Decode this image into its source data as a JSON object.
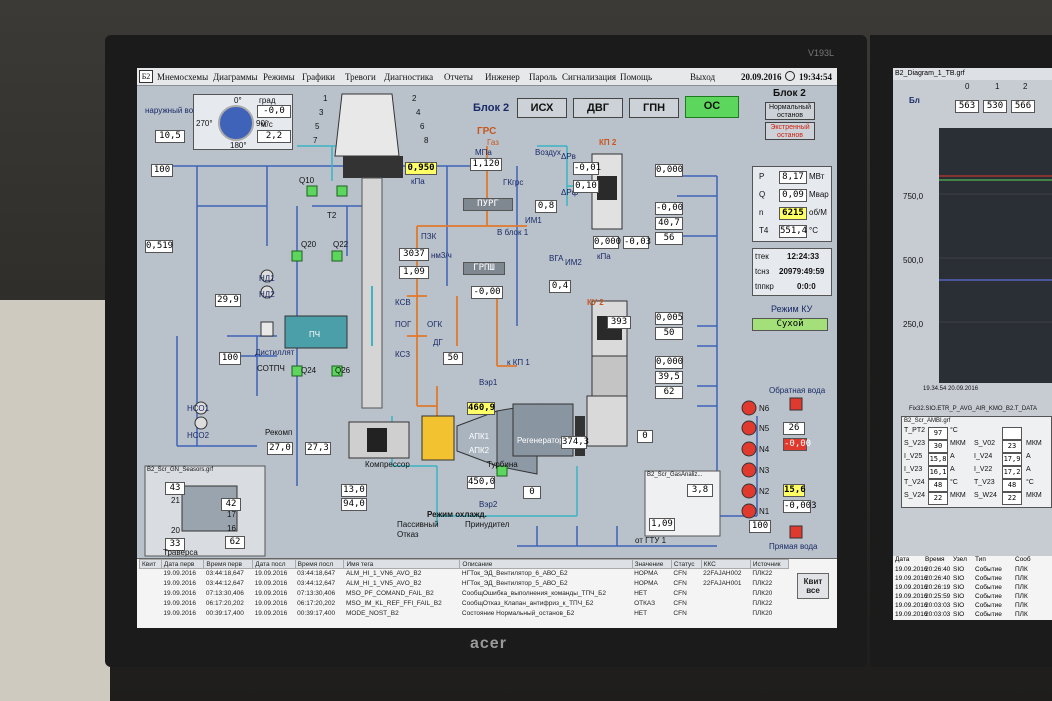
{
  "monitor": {
    "brand": "acer",
    "model": "V193L"
  },
  "menu": {
    "logo": "Б2",
    "items": [
      "Мнемосхемы",
      "Диаграммы",
      "Режимы",
      "Графики",
      "Тревоги",
      "Диагностика",
      "Отчеты",
      "Инженер",
      "Пароль",
      "Сигнализация",
      "Помощь"
    ],
    "exit": "Выход",
    "date": "20.09.2016",
    "time": "19:34:54"
  },
  "header": {
    "block_label": "Блок 2",
    "mode_buttons": [
      "ИСХ",
      "ДВГ",
      "ГПН",
      "ОС"
    ],
    "active_mode": "ОС",
    "right_title": "Блок 2",
    "normal_stop": "Нормальный останов",
    "emergency_stop": "Экстренный останов"
  },
  "weather": {
    "outside_air_label": "наружный воздух",
    "air_temp": "10,5",
    "wind_deg_label": "град",
    "wind_deg": "-0,0",
    "wind_speed_label": "м/с",
    "wind_speed": "2,2",
    "compass": [
      "0°",
      "90°",
      "180°",
      "270°"
    ]
  },
  "power_panel": {
    "rows": [
      {
        "name": "P",
        "value": "8,17",
        "unit": "МВт"
      },
      {
        "name": "Q",
        "value": "0,09",
        "unit": "Мвар"
      },
      {
        "name": "n",
        "value": "6215",
        "unit": "об/М"
      },
      {
        "name": "T4",
        "value": "551,4",
        "unit": "°C"
      }
    ],
    "ttek_label": "tтек",
    "ttek": "12:24:33",
    "tsnz_label": "tснз",
    "tsnz": "20979:49:59",
    "tppk_label": "tппкр",
    "tppk": "0:0:0",
    "ku_mode_label": "Режим КУ",
    "ku_mode": "Сухой"
  },
  "gas": {
    "grs": "ГРС",
    "gas_label": "Газ",
    "mpa": "МПа",
    "grs_pressure": "1,120",
    "gkgrs": "ГКгрс",
    "purg": "ПУРГ",
    "v_block": "В блок 1",
    "pzk": "ПЗК",
    "flow": "3037",
    "flow_unit": "нм3/ч",
    "p2": "1,09",
    "grpsh": "ГРПШ",
    "p3": "-0,00",
    "ksv": "КСВ",
    "kpg": "ПОГ",
    "ogk": "ОГК",
    "dg": "ДГ",
    "ksz": "КСЗ",
    "val50": "50",
    "to_kp1": "к КП 1"
  },
  "filter": {
    "vozduh": "Воздух",
    "im1": "ИМ1",
    "im2": "ИМ2",
    "vga": "ВГА",
    "dpv": "ΔРв",
    "dpf": "ΔРф",
    "v08": "0,8",
    "v04": "0,4",
    "kp2": "КП 2",
    "p_a": "-0,01",
    "p_b": "0,10",
    "p_c": "0,000",
    "p_d": "-0,03",
    "kpa": "кПа"
  },
  "kp2_right": {
    "v1": "0,000",
    "v2": "-0,00",
    "v3": "40,7",
    "v4": "56"
  },
  "ku2": {
    "label": "КУ 2",
    "temp": "393",
    "v1": "0,005",
    "v2": "50",
    "v3": "0,000",
    "v4": "39,5",
    "v5": "62"
  },
  "left": {
    "v100": "100",
    "v0519": "0,519",
    "v299": "29,9",
    "v100b": "100",
    "nd1": "НД1",
    "nd2": "НД2",
    "nso1": "НСО1",
    "nso2": "НСО2",
    "sotpch": "СОТПЧ",
    "distil": "Дистиллят",
    "q10": "Q10",
    "q20": "Q20",
    "q22": "Q22",
    "q24": "Q24",
    "q26": "Q26",
    "t2": "T2",
    "pch": "ПЧ"
  },
  "stack": {
    "p0950": "0,950",
    "kpa": "кПа"
  },
  "turbine": {
    "compressor": "Компрессор",
    "turbine": "Турбина",
    "regenerator": "Регенератор",
    "apk1": "АПК1",
    "apk2": "АПК2",
    "t4609": "460,9",
    "t4500": "450,0",
    "t3743": "374,3",
    "v0": "0",
    "v0b": "0",
    "bzr1": "Вэр1",
    "bzr2": "Вэр2",
    "v130": "13,0",
    "v940": "94,0",
    "v270": "27,0",
    "v273": "27,3",
    "vraschenie": "Рекомп"
  },
  "cooling": {
    "title": "Режим охлажд.",
    "passive": "Пассивный",
    "forced": "Принудител",
    "fail": "Отказ"
  },
  "gas_small_win": {
    "title": "B2_Scr_GasAnaliz...",
    "v1": "3,8",
    "v2": "1,09"
  },
  "seals_win": {
    "title": "B2_Scr_GN_Seasors.grf",
    "v1": "43",
    "v2": "42",
    "v3": "33",
    "v4": "62",
    "n21": "21",
    "n20": "20",
    "n17": "17",
    "n16": "16",
    "traversa": "Траверса"
  },
  "water": {
    "return_label": "Обратная вода",
    "direct_label": "Прямая вода",
    "pumps": [
      "N6",
      "N5",
      "N4",
      "N3",
      "N2",
      "N1"
    ],
    "v26": "26",
    "vm000": "-0,00",
    "v156": "15,6",
    "vm0003": "-0,003",
    "v100": "100",
    "from_gtu": "от ГТУ 1"
  },
  "sieve_bins": [
    {
      "no": "1",
      "state": "ok"
    },
    {
      "no": "2",
      "state": "ok"
    },
    {
      "no": "3",
      "state": "ok"
    },
    {
      "no": "4",
      "state": "ok"
    },
    {
      "no": "5",
      "state": "ok"
    },
    {
      "no": "6",
      "state": "ok"
    },
    {
      "no": "7",
      "state": "ok"
    },
    {
      "no": "8",
      "state": "ok"
    }
  ],
  "events": {
    "columns": [
      "Квит",
      "Дата перв",
      "Время перв",
      "Дата посл",
      "Время посл",
      "Имя тега",
      "Описание",
      "Значение",
      "Статус",
      "ККС",
      "Источник"
    ],
    "rows": [
      [
        "",
        "19.09.2016",
        "03:44:18,647",
        "19.09.2016",
        "03:44:18,647",
        "ALM_HI_1_VN6_AVO_B2",
        "НГТок_ЭД_Вентилятор_6_АВО_Б2",
        "НОРМА",
        "CFN",
        "22FAJAH002",
        "ПЛК22"
      ],
      [
        "",
        "19.09.2016",
        "03:44:12,647",
        "19.09.2016",
        "03:44:12,647",
        "ALM_HI_1_VN5_AVO_B2",
        "НГТок_ЭД_Вентилятор_5_АВО_Б2",
        "НОРМА",
        "CFN",
        "22FAJAH001",
        "ПЛК22"
      ],
      [
        "",
        "19.09.2016",
        "07:13:30,406",
        "19.09.2016",
        "07:13:30,406",
        "MSO_PF_COMAND_FAIL_B2",
        "СообщОшибка_выполнения_команды_ТПЧ_Б2",
        "НЕТ",
        "CFN",
        "",
        "ПЛК20"
      ],
      [
        "",
        "19.09.2016",
        "06:17:20,202",
        "19.09.2016",
        "06:17:20,202",
        "MSO_IM_KL_REF_FFI_FAIL_B2",
        "СообщОтказ_Клапан_антифриз_к_ТПЧ_Б2",
        "ОТКАЗ",
        "CFN",
        "",
        "ПЛК22"
      ],
      [
        "",
        "19.09.2016",
        "00:39:17,400",
        "19.09.2016",
        "00:39:17,400",
        "MODE_NOST_B2",
        "Состояние Нормальный_останов_Б2",
        "НЕТ",
        "CFN",
        "",
        "ПЛК20"
      ]
    ],
    "kvit_all": "Квит все"
  },
  "screen2": {
    "title": "B2_Diagram_1_TB.grf",
    "block_label": "Бл",
    "counters": [
      "563",
      "530",
      "566"
    ],
    "counters_top": [
      "0",
      "1",
      "2"
    ],
    "y_ticks": [
      "750,0",
      "500,0",
      "250,0"
    ],
    "chart_date": "19.34.54 20.09.2016",
    "trend_title": "Fix32.SIO.ETR_P_AVG_AIR_KMO_B2.T_DATA",
    "amb_title": "B2_Scr_AMBI.grf",
    "amb_rows": [
      {
        "l": "T_PT2",
        "v": "97",
        "u": "°C",
        "l2": "",
        "v2": "",
        "u2": ""
      },
      {
        "l": "S_V23",
        "v": "30",
        "u": "МКМ",
        "l2": "S_V02",
        "v2": "23",
        "u2": "МКМ"
      },
      {
        "l": "I_V25",
        "v": "15,8",
        "u": "А",
        "l2": "I_V24",
        "v2": "17,9",
        "u2": "А"
      },
      {
        "l": "I_V23",
        "v": "16,1",
        "u": "А",
        "l2": "I_V22",
        "v2": "17,2",
        "u2": "А"
      },
      {
        "l": "T_V24",
        "v": "48",
        "u": "°C",
        "l2": "T_V23",
        "v2": "48",
        "u2": "°C"
      },
      {
        "l": "S_V24",
        "v": "22",
        "u": "МКМ",
        "l2": "S_W24",
        "v2": "22",
        "u2": "МКМ"
      }
    ],
    "ev_cols": [
      "Дата",
      "Время",
      "Узел",
      "Тип",
      "Сооб"
    ],
    "ev_rows": [
      [
        "19.09.2016",
        "20:26:40",
        "SIO",
        "Событие",
        "ПЛК"
      ],
      [
        "19.09.2016",
        "20:26:40",
        "SIO",
        "Событие",
        "ПЛК"
      ],
      [
        "19.09.2016",
        "20:26:19",
        "SIO",
        "Событие",
        "ПЛК"
      ],
      [
        "19.09.2016",
        "20:25:59",
        "SIO",
        "Событие",
        "ПЛК"
      ],
      [
        "19.09.2016",
        "20:03:03",
        "SIO",
        "Событие",
        "ПЛК"
      ],
      [
        "19.09.2016",
        "20:03:03",
        "SIO",
        "Событие",
        "ПЛК"
      ]
    ]
  },
  "colors": {
    "active_green": "#5cd65c",
    "alarm_red": "#e03a2f",
    "value_yellow": "#ffff66",
    "pipe_blue": "#3f63b8",
    "pipe_orange": "#e07a2c",
    "pipe_cyan": "#3ab5c4"
  }
}
